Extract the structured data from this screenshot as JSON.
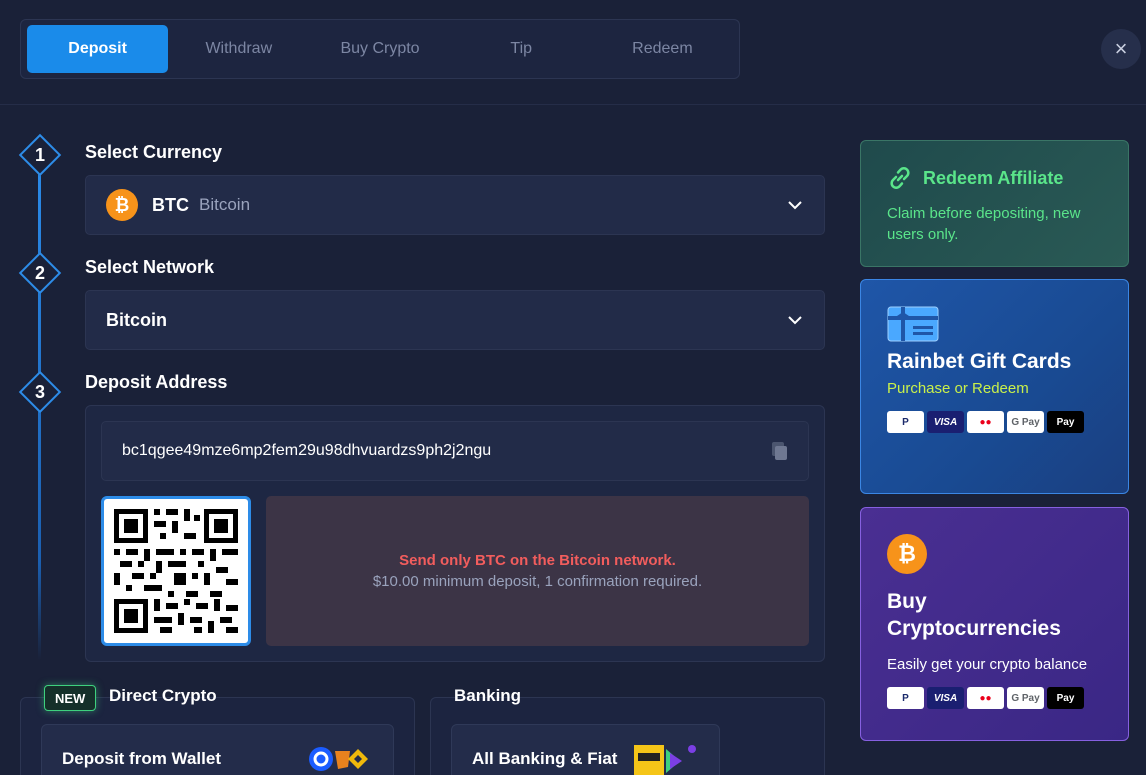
{
  "tabs": [
    {
      "label": "Deposit",
      "active": true
    },
    {
      "label": "Withdraw"
    },
    {
      "label": "Buy Crypto"
    },
    {
      "label": "Tip"
    },
    {
      "label": "Redeem"
    }
  ],
  "close_icon": "×",
  "steps": {
    "s1": {
      "num": "1",
      "label": "Select Currency"
    },
    "s2": {
      "num": "2",
      "label": "Select Network"
    },
    "s3": {
      "num": "3",
      "label": "Deposit Address"
    }
  },
  "currency": {
    "symbol": "BTC",
    "name": "Bitcoin",
    "coin_glyph": "₿"
  },
  "network": {
    "name": "Bitcoin"
  },
  "deposit": {
    "address": "bc1qgee49mze6mp2fem29u98dhvuardzs9ph2j2ngu",
    "warning": "Send only BTC on the Bitcoin network.",
    "note": "$10.00 minimum deposit, 1 confirmation required."
  },
  "bottom": {
    "badge": "NEW",
    "direct_title": "Direct Crypto",
    "banking_title": "Banking",
    "wallet_card": "Deposit from Wallet",
    "banking_card": "All Banking & Fiat"
  },
  "affiliate": {
    "title": "Redeem Affiliate",
    "desc": "Claim before depositing, new users only."
  },
  "giftcards": {
    "title": "Rainbet Gift Cards",
    "subtitle": "Purchase or Redeem"
  },
  "buycrypto": {
    "title": "Buy Cryptocurrencies",
    "desc": "Easily get your crypto balance",
    "coin_glyph": "₿"
  },
  "payments": [
    "P",
    "VISA",
    "●●",
    "G Pay",
    "Pay"
  ],
  "colors": {
    "accent": "#1a8bea",
    "success": "#5ae58a",
    "warning": "#f25d5d",
    "bitcoin": "#f7931a"
  }
}
